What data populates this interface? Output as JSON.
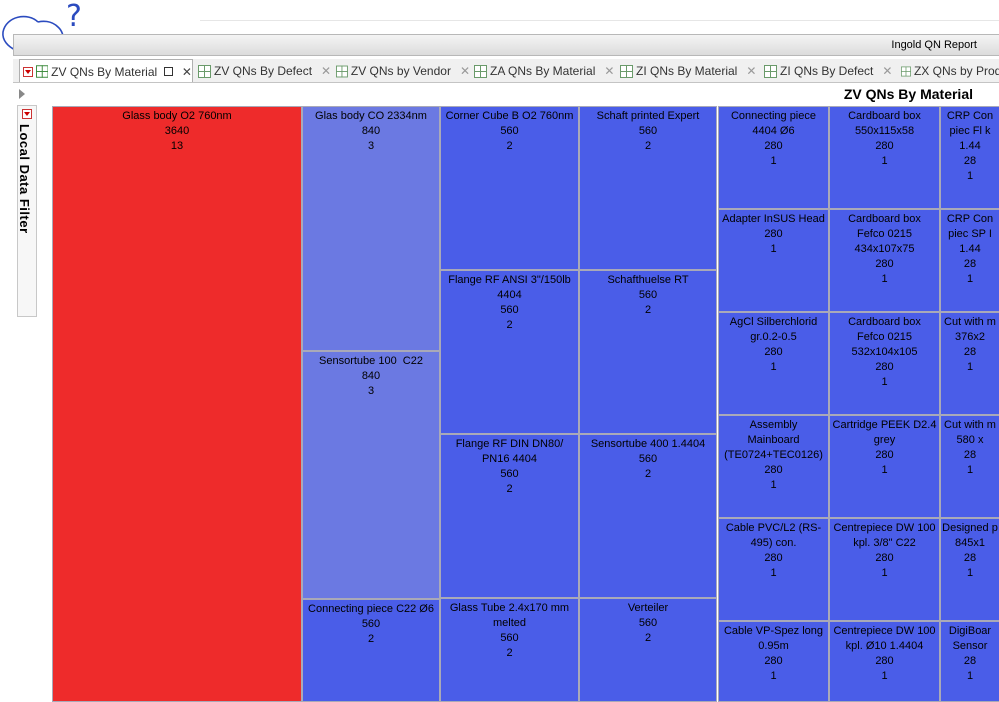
{
  "app": {
    "title": "Ingold QN Report"
  },
  "tabs": [
    {
      "label": "ZV QNs By Material",
      "active": true
    },
    {
      "label": "ZV QNs By Defect",
      "active": false
    },
    {
      "label": "ZV QNs by Vendor",
      "active": false
    },
    {
      "label": "ZA QNs By Material",
      "active": false
    },
    {
      "label": "ZI QNs By Material",
      "active": false
    },
    {
      "label": "ZI QNs By Defect",
      "active": false
    },
    {
      "label": "ZX QNs by Produ",
      "active": false
    }
  ],
  "sidebar": {
    "filter_label": "Local Data Filter"
  },
  "viz": {
    "title": "ZV QNs By Material"
  },
  "annotation": {
    "text": "?"
  },
  "colors": {
    "highlight": "#ee2b2b",
    "cell": "#4a5de8",
    "cell_light": "#6b79e2"
  },
  "treemap": {
    "cells": [
      {
        "name": "Glass body O2 760nm",
        "value": "3640",
        "count": "13",
        "color": "#ee2b2b"
      },
      {
        "name": "Glas body CO 2334nm",
        "value": "840",
        "count": "3",
        "color": "#6b79e2"
      },
      {
        "name": "Sensortube 100  C22",
        "value": "840",
        "count": "3",
        "color": "#6b79e2"
      },
      {
        "name": "Connecting piece C22 Ø6",
        "value": "560",
        "count": "2",
        "color": "#4a5de8"
      },
      {
        "name": "Corner Cube B O2 760nm",
        "value": "560",
        "count": "2",
        "color": "#4a5de8"
      },
      {
        "name": "Flange RF ANSI 3\"/150lb\n4404",
        "value": "560",
        "count": "2",
        "color": "#4a5de8"
      },
      {
        "name": "Flange RF DIN DN80/\nPN16 4404",
        "value": "560",
        "count": "2",
        "color": "#4a5de8"
      },
      {
        "name": "Glass Tube 2.4x170 mm\nmelted",
        "value": "560",
        "count": "2",
        "color": "#4a5de8"
      },
      {
        "name": "Schaft printed Expert",
        "value": "560",
        "count": "2",
        "color": "#4a5de8"
      },
      {
        "name": "Schafthuelse RT",
        "value": "560",
        "count": "2",
        "color": "#4a5de8"
      },
      {
        "name": "Sensortube 400 1.4404",
        "value": "560",
        "count": "2",
        "color": "#4a5de8"
      },
      {
        "name": "Verteiler",
        "value": "560",
        "count": "2",
        "color": "#4a5de8"
      },
      {
        "name": "Connecting piece\n4404 Ø6",
        "value": "280",
        "count": "1",
        "color": "#4a5de8"
      },
      {
        "name": "Adapter InSUS Head",
        "value": "280",
        "count": "1",
        "color": "#4a5de8"
      },
      {
        "name": "AgCl Silberchlorid\ngr.0.2-0.5",
        "value": "280",
        "count": "1",
        "color": "#4a5de8"
      },
      {
        "name": "Assembly\nMainboard\n(TE0724+TEC0126)",
        "value": "280",
        "count": "1",
        "color": "#4a5de8"
      },
      {
        "name": "Cable PVC/L2 (RS-\n495) con.",
        "value": "280",
        "count": "1",
        "color": "#4a5de8"
      },
      {
        "name": "Cable VP-Spez long\n0.95m",
        "value": "280",
        "count": "1",
        "color": "#4a5de8"
      },
      {
        "name": "Cardboard box\n550x115x58",
        "value": "280",
        "count": "1",
        "color": "#4a5de8"
      },
      {
        "name": "Cardboard box\nFefco 0215\n434x107x75",
        "value": "280",
        "count": "1",
        "color": "#4a5de8"
      },
      {
        "name": "Cardboard box\nFefco 0215\n532x104x105",
        "value": "280",
        "count": "1",
        "color": "#4a5de8"
      },
      {
        "name": "Cartridge PEEK D2.4\ngrey",
        "value": "280",
        "count": "1",
        "color": "#4a5de8"
      },
      {
        "name": "Centrepiece DW 100\nkpl. 3/8\" C22",
        "value": "280",
        "count": "1",
        "color": "#4a5de8"
      },
      {
        "name": "Centrepiece DW 100\nkpl. Ø10 1.4404",
        "value": "280",
        "count": "1",
        "color": "#4a5de8"
      },
      {
        "name": "CRP Con\npiec Fl k",
        "value": "1.44",
        "count": "28",
        "extra": "1",
        "color": "#4a5de8"
      },
      {
        "name": "CRP Con\npiec SP I",
        "value": "1.44",
        "count": "28",
        "extra": "1",
        "color": "#4a5de8"
      },
      {
        "name": "Cut with m\n376x2",
        "value": "28",
        "count": "1",
        "color": "#4a5de8"
      },
      {
        "name": "Cut with m\n580 x",
        "value": "28",
        "count": "1",
        "color": "#4a5de8"
      },
      {
        "name": "Designed p\n845x1",
        "value": "28",
        "count": "1",
        "color": "#4a5de8"
      },
      {
        "name": "DigiBoar\nSensor",
        "value": "28",
        "count": "1",
        "color": "#4a5de8"
      }
    ]
  }
}
